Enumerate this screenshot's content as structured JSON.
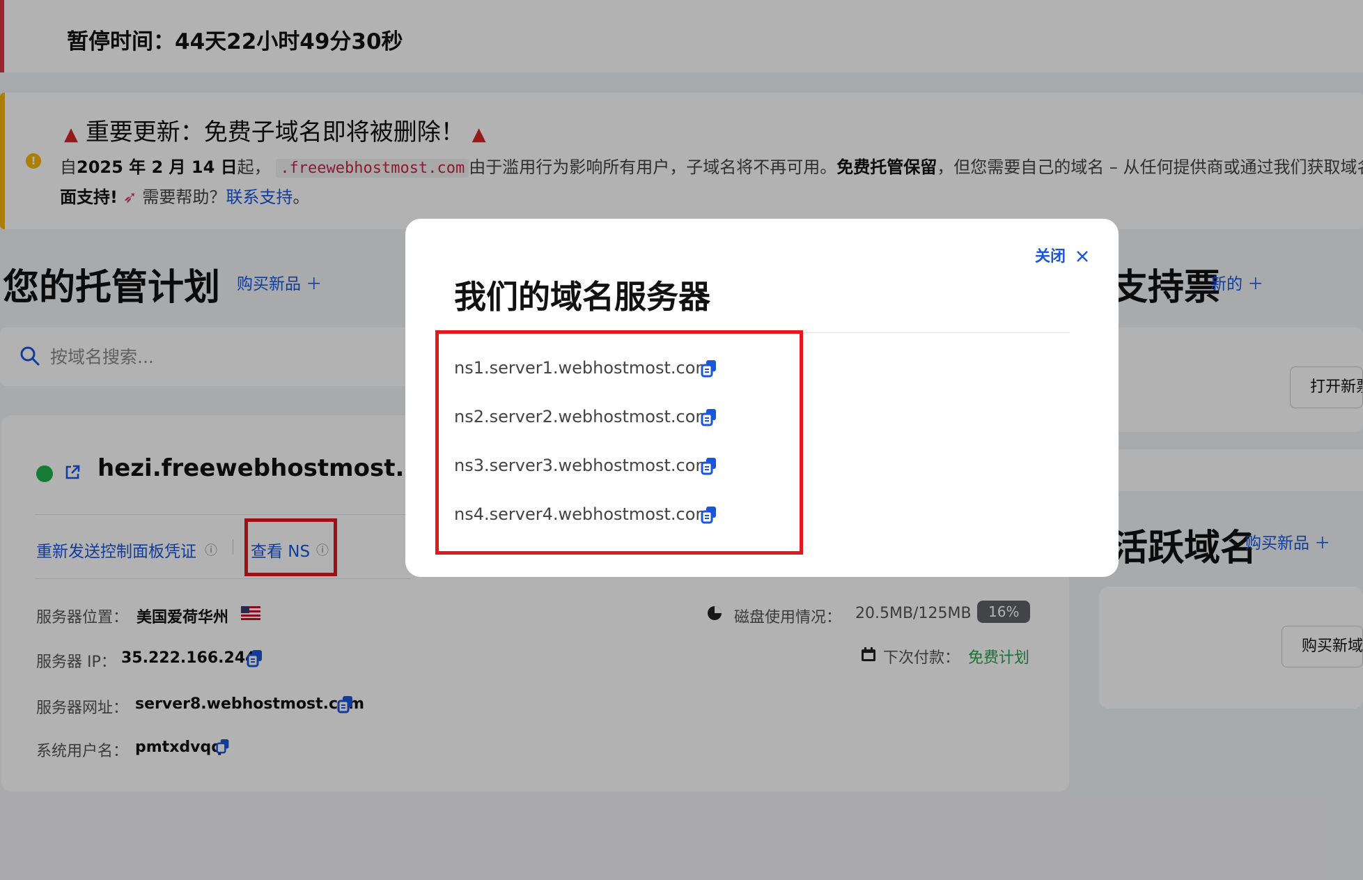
{
  "pause_banner": {
    "text": "暂停时间：44天22小时49分30秒"
  },
  "alert": {
    "title": "重要更新：免费子域名即将被删除！",
    "line1_prefix": "自",
    "line1_date": "2025 年 2 月 14 日",
    "line1_after_date": "起，",
    "line1_domain": ".freewebhostmost.com",
    "line1_middle": "由于滥用行为影响所有用户，子域名将不再可用。",
    "line1_bold": "免费托管保留",
    "line1_end": "，但您需要自己的域名 – 从任何提供商或通过我们获取域名",
    "line2_bold": "面支持!",
    "line2_help": "需要帮助？",
    "line2_link": "联系支持",
    "line2_end": "。"
  },
  "hosting": {
    "title": "您的托管计划",
    "buy_new": "购买新品 ＋",
    "search_placeholder": "按域名搜索..."
  },
  "site": {
    "domain": "hezi.freewebhostmost.com",
    "resend_link": "重新发送控制面板凭证",
    "view_ns": "查看 NS",
    "server_location_label": "服务器位置：",
    "server_location_value": "美国爱荷华州",
    "server_ip_label": "服务器 IP：",
    "server_ip_value": "35.222.166.244",
    "server_url_label": "服务器网址：",
    "server_url_value": "server8.webhostmost.com",
    "username_label": "系统用户名：",
    "username_value": "pmtxdvqq",
    "disk_label": "磁盘使用情况：",
    "disk_value": "20.5MB/125MB",
    "disk_percent": "16%",
    "next_payment_label": "下次付款：",
    "next_payment_value": "免费计划"
  },
  "support": {
    "title": "支持票",
    "new": "新的 ＋",
    "open_button": "打开新票"
  },
  "active_domains": {
    "title": "活跃域名",
    "buy_new": "购买新品 ＋",
    "buy_button": "购买新域名"
  },
  "modal": {
    "title": "我们的域名服务器",
    "close": "关闭",
    "nameservers": [
      "ns1.server1.webhostmost.com",
      "ns2.server2.webhostmost.com",
      "ns3.server3.webhostmost.com",
      "ns4.server4.webhostmost.com"
    ]
  },
  "colors": {
    "link_blue": "#1a56db",
    "status_green": "#22b14c",
    "highlight_red": "#e0191f",
    "alert_yellow": "#f5b50a",
    "pause_red": "#dc3545"
  }
}
